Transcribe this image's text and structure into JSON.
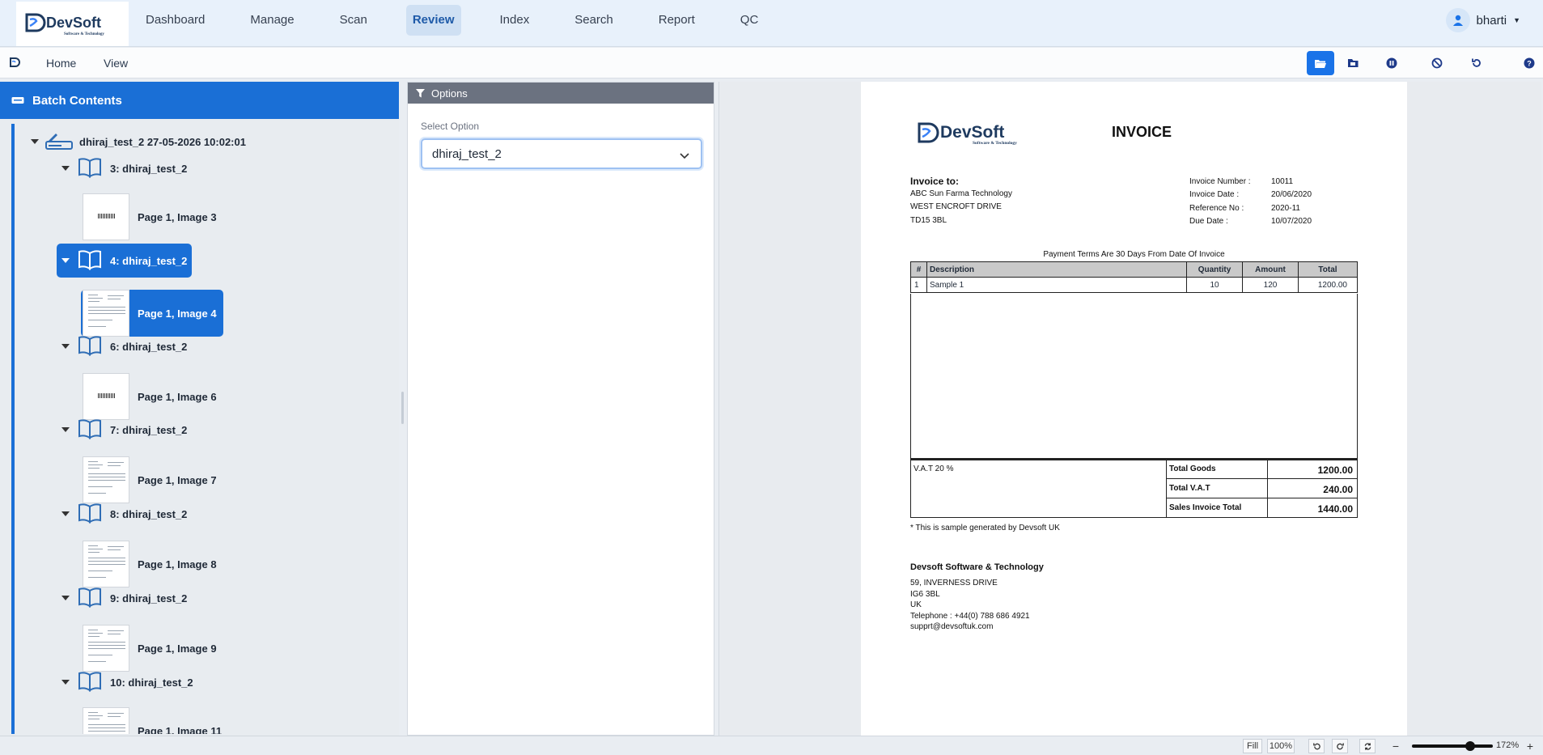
{
  "app": {
    "logo_text": "DevSoft",
    "logo_tagline": "Software & Technology",
    "nav": [
      "Dashboard",
      "Manage",
      "Scan",
      "Review",
      "Index",
      "Search",
      "Report",
      "QC"
    ],
    "active_nav": "Review",
    "user_name": "bharti"
  },
  "subbar": {
    "links": [
      "Home",
      "View"
    ],
    "tool_icons": [
      "open-folder-icon",
      "folder-icon",
      "pause-icon",
      "block-icon",
      "refresh-icon",
      "help-icon"
    ]
  },
  "left_panel": {
    "title": "Batch Contents",
    "root_label": "dhiraj_test_2 27-05-2026 10:02:01",
    "documents": [
      {
        "label": "3: dhiraj_test_2",
        "page": "Page 1, Image 3",
        "thumb": "barcode",
        "selected": false
      },
      {
        "label": "4: dhiraj_test_2",
        "page": "Page 1, Image 4",
        "thumb": "invoice",
        "selected": true
      },
      {
        "label": "6: dhiraj_test_2",
        "page": "Page 1, Image 6",
        "thumb": "barcode",
        "selected": false
      },
      {
        "label": "7: dhiraj_test_2",
        "page": "Page 1, Image 7",
        "thumb": "invoice",
        "selected": false
      },
      {
        "label": "8: dhiraj_test_2",
        "page": "Page 1, Image 8",
        "thumb": "invoice",
        "selected": false
      },
      {
        "label": "9: dhiraj_test_2",
        "page": "Page 1, Image 9",
        "thumb": "invoice",
        "selected": false
      },
      {
        "label": "10: dhiraj_test_2",
        "page": "Page 1, Image 11",
        "thumb": "invoice",
        "selected": false
      }
    ]
  },
  "options_panel": {
    "title": "Options",
    "select_label": "Select Option",
    "select_value": "dhiraj_test_2"
  },
  "invoice": {
    "logo_text": "DevSoft",
    "logo_tagline": "Software & Technology",
    "title": "INVOICE",
    "to_label": "Invoice to:",
    "to_lines": [
      "ABC Sun Farma Technology",
      "WEST ENCROFT DRIVE",
      "TD15 3BL"
    ],
    "meta": [
      {
        "k": "Invoice Number :",
        "v": "10011"
      },
      {
        "k": "Invoice Date :",
        "v": "20/06/2020"
      },
      {
        "k": "Reference No :",
        "v": "2020-11"
      },
      {
        "k": "Due Date :",
        "v": "10/07/2020"
      }
    ],
    "payment_terms": "Payment Terms Are 30 Days From Date Of Invoice",
    "table_headers": [
      "#",
      "Description",
      "Quantity",
      "Amount",
      "Total"
    ],
    "rows": [
      {
        "n": "1",
        "desc": "Sample 1",
        "qty": "10",
        "amt": "120",
        "total": "1200.00"
      }
    ],
    "vat_label": "V.A.T 20 %",
    "totals": [
      {
        "k": "Total Goods",
        "v": "1200.00"
      },
      {
        "k": "Total V.A.T",
        "v": "240.00"
      },
      {
        "k": "Sales Invoice Total",
        "v": "1440.00"
      }
    ],
    "note": "* This is sample generated by Devsoft UK",
    "company": "Devsoft Software & Technology",
    "address": [
      "59, INVERNESS DRIVE",
      "IG6 3BL",
      "UK",
      "Telephone : +44(0) 788 686 4921",
      "supprt@devsoftuk.com"
    ]
  },
  "statusbar": {
    "fill": "Fill",
    "zoom_100": "100%",
    "zoom_level": "172%",
    "zoom_fraction": 0.72
  }
}
